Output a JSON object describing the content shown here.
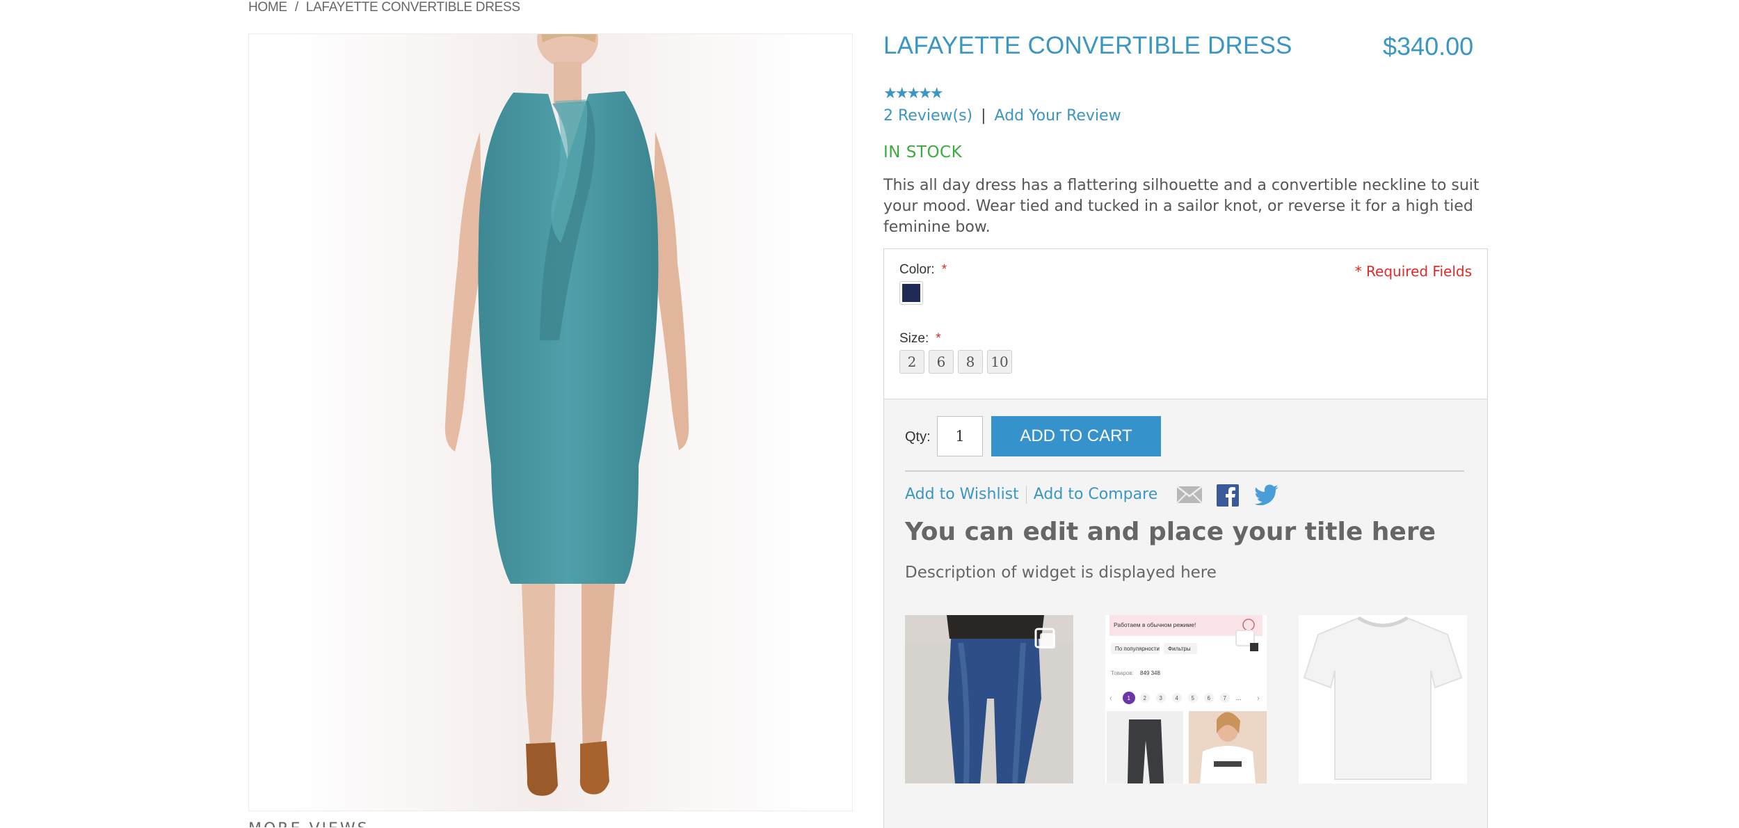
{
  "breadcrumb": {
    "home": "HOME",
    "separator": "/",
    "current": "LAFAYETTE CONVERTIBLE DRESS"
  },
  "below_gallery_text": "MORE VIEWS",
  "product": {
    "title": "LAFAYETTE CONVERTIBLE DRESS",
    "price": "$340.00",
    "stars": "★★★★★",
    "rating_stars": 5,
    "reviews_link": "2 Review(s)",
    "reviews_separator": "|",
    "add_review_link": "Add Your Review",
    "stock": "IN STOCK",
    "description": "This all day dress has a flattering silhouette and a convertible neckline to suit your mood. Wear tied and tucked in a sailor knot, or reverse it for a high tied feminine bow."
  },
  "options": {
    "color_label": "Color:",
    "size_label": "Size:",
    "required_star": "*",
    "required_note": "* Required Fields",
    "swatch_color": "#1f2a55",
    "sizes": [
      "2",
      "6",
      "8",
      "10"
    ]
  },
  "cart": {
    "qty_label": "Qty:",
    "qty_value": "1",
    "add_to_cart": "ADD TO CART",
    "wishlist": "Add to Wishlist",
    "compare": "Add to Compare"
  },
  "social_icons": [
    "email-icon",
    "facebook-icon",
    "twitter-icon"
  ],
  "widget": {
    "title": "You can edit and place your title here",
    "description": "Description of widget is displayed here",
    "thumb2": {
      "banner": "Работаем в обычном режиме!",
      "filter1": "По популярности",
      "filter2": "Фильтры",
      "count_label": "Товаров:",
      "count_value": "849 348",
      "pages": [
        "1",
        "2",
        "3",
        "4",
        "5",
        "6",
        "7",
        "..."
      ],
      "prev": "‹",
      "next": "›"
    }
  },
  "colors": {
    "accent_blue": "#3a96c2",
    "button_blue": "#3592cb",
    "in_stock_green": "#3bab3b",
    "required_red": "#e02b27"
  }
}
